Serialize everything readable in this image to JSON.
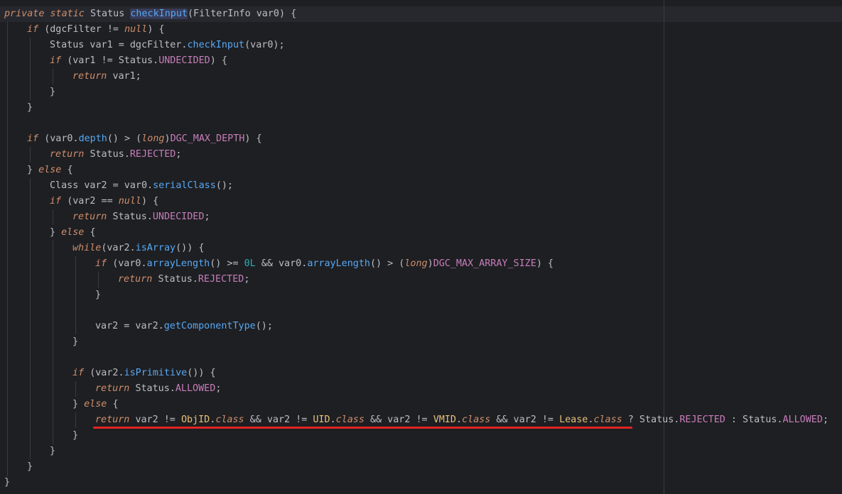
{
  "lines": [
    [
      [
        "kwi",
        "private "
      ],
      [
        "kwi",
        "static "
      ],
      [
        "cls",
        "Status "
      ],
      [
        "hlm",
        "checkInput"
      ],
      [
        "lbl",
        "(FilterInfo var0) {"
      ]
    ],
    [
      [
        "ind",
        ""
      ],
      [
        "kwi",
        "if "
      ],
      [
        "lbl",
        "(dgcFilter != "
      ],
      [
        "kwi",
        "null"
      ],
      [
        "lbl",
        ") {"
      ]
    ],
    [
      [
        "lbl",
        "Status var1 = dgcFilter."
      ],
      [
        "method",
        "checkInput"
      ],
      [
        "lbl",
        "(var0);"
      ]
    ],
    [
      [
        "kwi",
        "if "
      ],
      [
        "lbl",
        "(var1 != Status."
      ],
      [
        "const",
        "UNDECIDED"
      ],
      [
        "lbl",
        ") {"
      ]
    ],
    [
      [
        "ret",
        "return "
      ],
      [
        "lbl",
        "var1;"
      ]
    ],
    [
      [
        "lbl",
        "}"
      ]
    ],
    [
      [
        "lbl",
        "}"
      ]
    ],
    [
      [
        "lbl",
        ""
      ]
    ],
    [
      [
        "kwi",
        "if "
      ],
      [
        "lbl",
        "(var0."
      ],
      [
        "method",
        "depth"
      ],
      [
        "lbl",
        "() > ("
      ],
      [
        "kwi",
        "long"
      ],
      [
        "lbl",
        ")"
      ],
      [
        "const",
        "DGC_MAX_DEPTH"
      ],
      [
        "lbl",
        ") {"
      ]
    ],
    [
      [
        "ret",
        "return "
      ],
      [
        "lbl",
        "Status."
      ],
      [
        "const",
        "REJECTED"
      ],
      [
        "lbl",
        ";"
      ]
    ],
    [
      [
        "lbl",
        "} "
      ],
      [
        "kwi",
        "else "
      ],
      [
        "lbl",
        "{"
      ]
    ],
    [
      [
        "lbl",
        "Class var2 = var0."
      ],
      [
        "method",
        "serialClass"
      ],
      [
        "lbl",
        "();"
      ]
    ],
    [
      [
        "kwi",
        "if "
      ],
      [
        "lbl",
        "(var2 == "
      ],
      [
        "kwi",
        "null"
      ],
      [
        "lbl",
        ") {"
      ]
    ],
    [
      [
        "ret",
        "return "
      ],
      [
        "lbl",
        "Status."
      ],
      [
        "const",
        "UNDECIDED"
      ],
      [
        "lbl",
        ";"
      ]
    ],
    [
      [
        "lbl",
        "} "
      ],
      [
        "kwi",
        "else "
      ],
      [
        "lbl",
        "{"
      ]
    ],
    [
      [
        "kwi",
        "while"
      ],
      [
        "lbl",
        "(var2."
      ],
      [
        "method",
        "isArray"
      ],
      [
        "lbl",
        "()) {"
      ]
    ],
    [
      [
        "kwi",
        "if "
      ],
      [
        "lbl",
        "(var0."
      ],
      [
        "method",
        "arrayLength"
      ],
      [
        "lbl",
        "() >= "
      ],
      [
        "num",
        "0L"
      ],
      [
        "lbl",
        " && var0."
      ],
      [
        "method",
        "arrayLength"
      ],
      [
        "lbl",
        "() > ("
      ],
      [
        "kwi",
        "long"
      ],
      [
        "lbl",
        ")"
      ],
      [
        "const",
        "DGC_MAX_ARRAY_SIZE"
      ],
      [
        "lbl",
        ") {"
      ]
    ],
    [
      [
        "ret",
        "return "
      ],
      [
        "lbl",
        "Status."
      ],
      [
        "const",
        "REJECTED"
      ],
      [
        "lbl",
        ";"
      ]
    ],
    [
      [
        "lbl",
        "}"
      ]
    ],
    [
      [
        "lbl",
        ""
      ]
    ],
    [
      [
        "lbl",
        "var2 = var2."
      ],
      [
        "method",
        "getComponentType"
      ],
      [
        "lbl",
        "();"
      ]
    ],
    [
      [
        "lbl",
        "}"
      ]
    ],
    [
      [
        "lbl",
        ""
      ]
    ],
    [
      [
        "kwi",
        "if "
      ],
      [
        "lbl",
        "(var2."
      ],
      [
        "method",
        "isPrimitive"
      ],
      [
        "lbl",
        "()) {"
      ]
    ],
    [
      [
        "ret",
        "return "
      ],
      [
        "lbl",
        "Status."
      ],
      [
        "const",
        "ALLOWED"
      ],
      [
        "lbl",
        ";"
      ]
    ],
    [
      [
        "lbl",
        "} "
      ],
      [
        "kwi",
        "else "
      ],
      [
        "lbl",
        "{"
      ]
    ],
    [
      [
        "ret",
        "return "
      ],
      [
        "lbl",
        "var2 != "
      ],
      [
        "hcls",
        "ObjID"
      ],
      [
        "lbl",
        "."
      ],
      [
        "kwi",
        "class"
      ],
      [
        "lbl",
        " && var2 != "
      ],
      [
        "hcls",
        "UID"
      ],
      [
        "lbl",
        "."
      ],
      [
        "kwi",
        "class"
      ],
      [
        "lbl",
        " && var2 != "
      ],
      [
        "hcls",
        "VMID"
      ],
      [
        "lbl",
        "."
      ],
      [
        "kwi",
        "class"
      ],
      [
        "lbl",
        " && var2 != "
      ],
      [
        "hcls",
        "Lease"
      ],
      [
        "lbl",
        "."
      ],
      [
        "kwi",
        "class"
      ],
      [
        "lbl",
        " ? Status."
      ],
      [
        "const",
        "REJECTED"
      ],
      [
        "lbl",
        " : Status."
      ],
      [
        "const",
        "ALLOWED"
      ],
      [
        "lbl",
        ";"
      ]
    ],
    [
      [
        "lbl",
        "}"
      ]
    ],
    [
      [
        "lbl",
        "}"
      ]
    ],
    [
      [
        "lbl",
        "}"
      ]
    ],
    [
      [
        "lbl",
        "}"
      ]
    ]
  ],
  "indents": [
    0,
    1,
    2,
    2,
    3,
    2,
    1,
    0,
    1,
    2,
    1,
    2,
    2,
    3,
    2,
    3,
    4,
    5,
    4,
    0,
    4,
    3,
    0,
    3,
    4,
    3,
    4,
    3,
    2,
    1,
    0
  ],
  "colors": {
    "background": "#1e1f22",
    "keyword": "#cf8e6d",
    "method": "#56a8f5",
    "constant": "#c77dbb",
    "number": "#2aacb8",
    "text": "#bcbec4",
    "underline": "#e02424"
  }
}
